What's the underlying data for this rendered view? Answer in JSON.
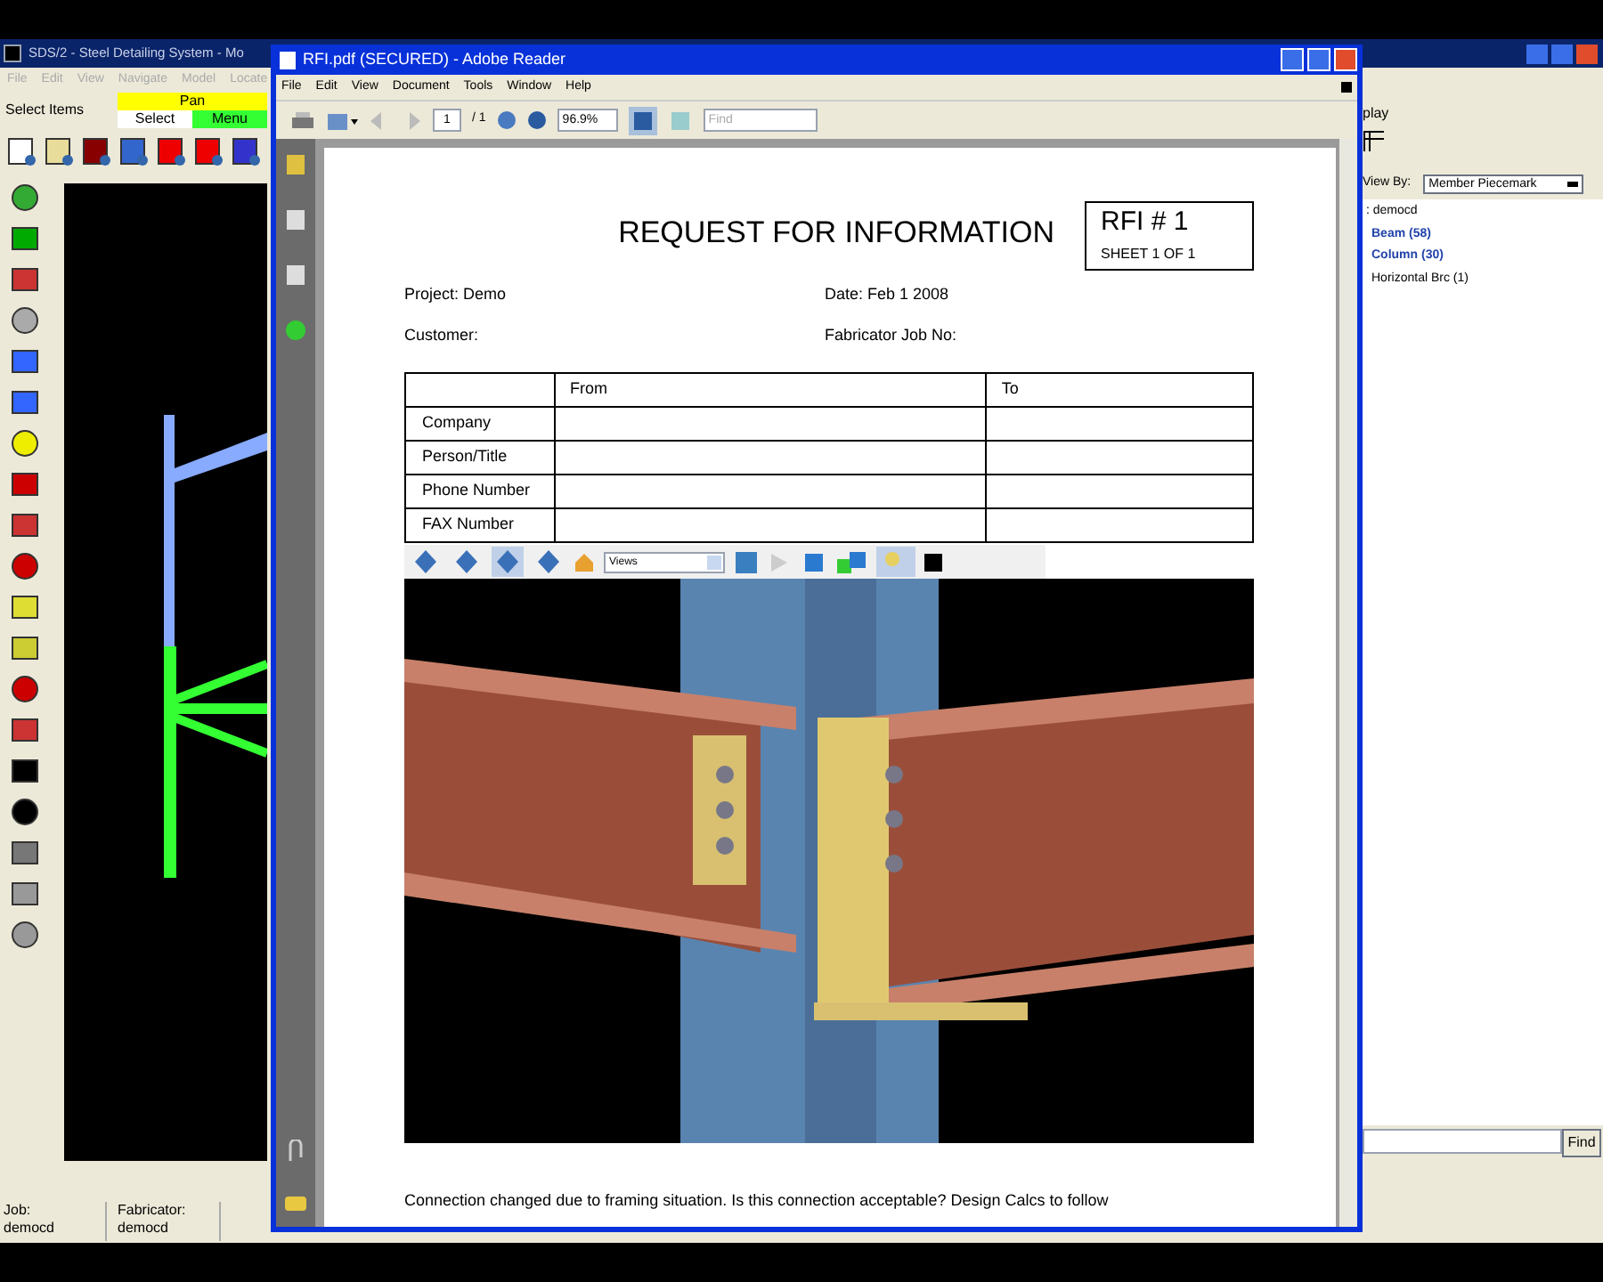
{
  "background_app": {
    "title": "SDS/2 - Steel Detailing System - Mo",
    "menu": [
      "File",
      "Edit",
      "View",
      "Navigate",
      "Model",
      "Locate"
    ],
    "mode_label": "Select Items",
    "mode_buttons": [
      {
        "label": "Pan",
        "color": "#ffff00"
      },
      {
        "label": "Select",
        "color": "#ffffff"
      },
      {
        "label": "Menu",
        "color": "#33ff33"
      }
    ],
    "right_panel": {
      "section_label": "play",
      "view_by_label": "View By:",
      "view_by_value": "Member Piecemark",
      "tree": {
        "label": ": democd",
        "children": [
          {
            "label": "Beam (58)",
            "highlighted": true
          },
          {
            "label": "Column (30)",
            "highlighted": true
          },
          {
            "label": "Horizontal Brc (1)",
            "highlighted": false
          }
        ]
      },
      "find_button": "Find"
    },
    "status_bar": [
      {
        "label": "Job:",
        "value": "democd"
      },
      {
        "label": "Fabricator:",
        "value": "democd"
      }
    ]
  },
  "reader": {
    "title": "RFI.pdf (SECURED) - Adobe Reader",
    "menu": [
      "File",
      "Edit",
      "View",
      "Document",
      "Tools",
      "Window",
      "Help"
    ],
    "toolbar": {
      "page": "1",
      "page_total": "/ 1",
      "zoom": "96.9%",
      "find_placeholder": "Find"
    },
    "document": {
      "heading": "REQUEST FOR INFORMATION",
      "rfi_number": "RFI # 1",
      "sheet": "SHEET 1 OF 1",
      "fields": [
        {
          "label": "Project: Demo"
        },
        {
          "label": "Date: Feb 1 2008"
        },
        {
          "label": "Customer:"
        },
        {
          "label": "Fabricator Job No:"
        }
      ],
      "table": {
        "columns": [
          "From",
          "To"
        ],
        "rows": [
          {
            "label": "Company"
          },
          {
            "label": "Person/Title"
          },
          {
            "label": "Phone Number"
          },
          {
            "label": "FAX Number"
          }
        ]
      },
      "viewer_3d": {
        "views_placeholder": "Views",
        "tools": [
          {
            "selected": false
          },
          {
            "selected": false
          },
          {
            "selected": true
          },
          {
            "selected": false
          }
        ],
        "lighting_selected": true
      },
      "caption": "Connection changed due to framing situation. Is this connection acceptable? Design Calcs to follow"
    }
  }
}
